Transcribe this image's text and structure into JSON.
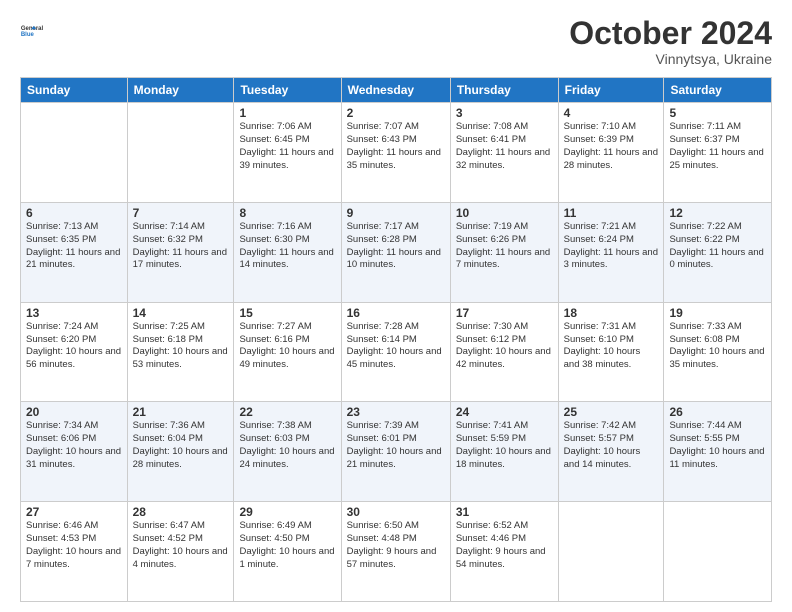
{
  "header": {
    "logo_line1": "General",
    "logo_line2": "Blue",
    "month": "October 2024",
    "location": "Vinnytsya, Ukraine"
  },
  "weekdays": [
    "Sunday",
    "Monday",
    "Tuesday",
    "Wednesday",
    "Thursday",
    "Friday",
    "Saturday"
  ],
  "rows": [
    [
      {
        "day": "",
        "text": ""
      },
      {
        "day": "",
        "text": ""
      },
      {
        "day": "1",
        "text": "Sunrise: 7:06 AM\nSunset: 6:45 PM\nDaylight: 11 hours and 39 minutes."
      },
      {
        "day": "2",
        "text": "Sunrise: 7:07 AM\nSunset: 6:43 PM\nDaylight: 11 hours and 35 minutes."
      },
      {
        "day": "3",
        "text": "Sunrise: 7:08 AM\nSunset: 6:41 PM\nDaylight: 11 hours and 32 minutes."
      },
      {
        "day": "4",
        "text": "Sunrise: 7:10 AM\nSunset: 6:39 PM\nDaylight: 11 hours and 28 minutes."
      },
      {
        "day": "5",
        "text": "Sunrise: 7:11 AM\nSunset: 6:37 PM\nDaylight: 11 hours and 25 minutes."
      }
    ],
    [
      {
        "day": "6",
        "text": "Sunrise: 7:13 AM\nSunset: 6:35 PM\nDaylight: 11 hours and 21 minutes."
      },
      {
        "day": "7",
        "text": "Sunrise: 7:14 AM\nSunset: 6:32 PM\nDaylight: 11 hours and 17 minutes."
      },
      {
        "day": "8",
        "text": "Sunrise: 7:16 AM\nSunset: 6:30 PM\nDaylight: 11 hours and 14 minutes."
      },
      {
        "day": "9",
        "text": "Sunrise: 7:17 AM\nSunset: 6:28 PM\nDaylight: 11 hours and 10 minutes."
      },
      {
        "day": "10",
        "text": "Sunrise: 7:19 AM\nSunset: 6:26 PM\nDaylight: 11 hours and 7 minutes."
      },
      {
        "day": "11",
        "text": "Sunrise: 7:21 AM\nSunset: 6:24 PM\nDaylight: 11 hours and 3 minutes."
      },
      {
        "day": "12",
        "text": "Sunrise: 7:22 AM\nSunset: 6:22 PM\nDaylight: 11 hours and 0 minutes."
      }
    ],
    [
      {
        "day": "13",
        "text": "Sunrise: 7:24 AM\nSunset: 6:20 PM\nDaylight: 10 hours and 56 minutes."
      },
      {
        "day": "14",
        "text": "Sunrise: 7:25 AM\nSunset: 6:18 PM\nDaylight: 10 hours and 53 minutes."
      },
      {
        "day": "15",
        "text": "Sunrise: 7:27 AM\nSunset: 6:16 PM\nDaylight: 10 hours and 49 minutes."
      },
      {
        "day": "16",
        "text": "Sunrise: 7:28 AM\nSunset: 6:14 PM\nDaylight: 10 hours and 45 minutes."
      },
      {
        "day": "17",
        "text": "Sunrise: 7:30 AM\nSunset: 6:12 PM\nDaylight: 10 hours and 42 minutes."
      },
      {
        "day": "18",
        "text": "Sunrise: 7:31 AM\nSunset: 6:10 PM\nDaylight: 10 hours and 38 minutes."
      },
      {
        "day": "19",
        "text": "Sunrise: 7:33 AM\nSunset: 6:08 PM\nDaylight: 10 hours and 35 minutes."
      }
    ],
    [
      {
        "day": "20",
        "text": "Sunrise: 7:34 AM\nSunset: 6:06 PM\nDaylight: 10 hours and 31 minutes."
      },
      {
        "day": "21",
        "text": "Sunrise: 7:36 AM\nSunset: 6:04 PM\nDaylight: 10 hours and 28 minutes."
      },
      {
        "day": "22",
        "text": "Sunrise: 7:38 AM\nSunset: 6:03 PM\nDaylight: 10 hours and 24 minutes."
      },
      {
        "day": "23",
        "text": "Sunrise: 7:39 AM\nSunset: 6:01 PM\nDaylight: 10 hours and 21 minutes."
      },
      {
        "day": "24",
        "text": "Sunrise: 7:41 AM\nSunset: 5:59 PM\nDaylight: 10 hours and 18 minutes."
      },
      {
        "day": "25",
        "text": "Sunrise: 7:42 AM\nSunset: 5:57 PM\nDaylight: 10 hours and 14 minutes."
      },
      {
        "day": "26",
        "text": "Sunrise: 7:44 AM\nSunset: 5:55 PM\nDaylight: 10 hours and 11 minutes."
      }
    ],
    [
      {
        "day": "27",
        "text": "Sunrise: 6:46 AM\nSunset: 4:53 PM\nDaylight: 10 hours and 7 minutes."
      },
      {
        "day": "28",
        "text": "Sunrise: 6:47 AM\nSunset: 4:52 PM\nDaylight: 10 hours and 4 minutes."
      },
      {
        "day": "29",
        "text": "Sunrise: 6:49 AM\nSunset: 4:50 PM\nDaylight: 10 hours and 1 minute."
      },
      {
        "day": "30",
        "text": "Sunrise: 6:50 AM\nSunset: 4:48 PM\nDaylight: 9 hours and 57 minutes."
      },
      {
        "day": "31",
        "text": "Sunrise: 6:52 AM\nSunset: 4:46 PM\nDaylight: 9 hours and 54 minutes."
      },
      {
        "day": "",
        "text": ""
      },
      {
        "day": "",
        "text": ""
      }
    ]
  ]
}
